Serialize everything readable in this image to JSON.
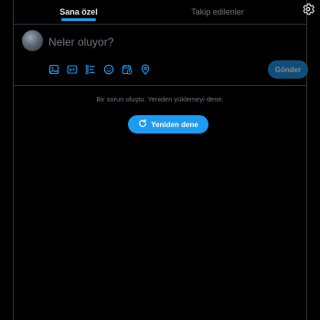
{
  "tabs": [
    {
      "label": "Sana özel",
      "active": true
    },
    {
      "label": "Takip edilenler",
      "active": false
    }
  ],
  "composer": {
    "placeholder": "Neler oluyor?",
    "send_label": "Gönder",
    "toolbar_icons": [
      "image-icon",
      "gif-icon",
      "poll-icon",
      "emoji-icon",
      "schedule-icon",
      "location-icon"
    ]
  },
  "error": {
    "message": "Bir sorun oluştu. Yeniden yüklemeyi dene.",
    "retry_label": "Yeniden dene"
  },
  "colors": {
    "background": "#000000",
    "accent": "#1d9bf0",
    "muted_text": "#71767b",
    "border": "#2f3336",
    "disabled_button": "#0f4e78"
  }
}
